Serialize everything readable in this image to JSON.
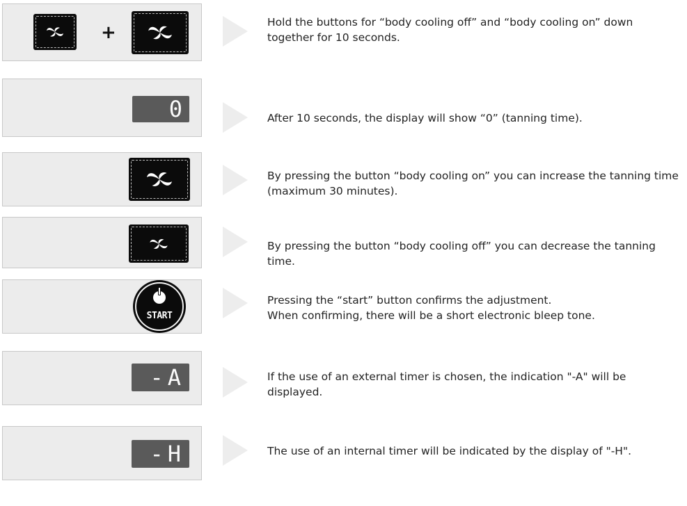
{
  "steps": [
    {
      "icon": "fan-buttons-combo",
      "text": "Hold the buttons for “body cooling off” and “body cooling on” down together for 10 seconds.",
      "plus": "+"
    },
    {
      "icon": "display",
      "text": "After 10 seconds, the display will show “0” (tanning time).",
      "display": "0"
    },
    {
      "icon": "fan-button-large",
      "text": "By pressing the button “body cooling on” you can increase the tanning time (maximum 30 minutes)."
    },
    {
      "icon": "fan-button-small",
      "text": "By pressing the button  “body cooling off”  you can decrease the tanning time."
    },
    {
      "icon": "power-icon",
      "text1": "Pressing the “start” button confirms the adjustment.",
      "text2": "When confirming, there will be a short electronic bleep tone.",
      "button_label": "START"
    },
    {
      "icon": "display",
      "text": "If the use of an external timer is chosen, the indication \"-A\" will be displayed.",
      "display": "-A"
    },
    {
      "icon": "display",
      "text": "The use of an internal timer will be indicated by the display of \"-H\".",
      "display": "-H"
    }
  ],
  "colors": {
    "panel": "#ececec",
    "panel_border": "#c8c8c8",
    "arrow": "#ededed",
    "button": "#0b0b0b",
    "display": "#5a5a5a"
  }
}
